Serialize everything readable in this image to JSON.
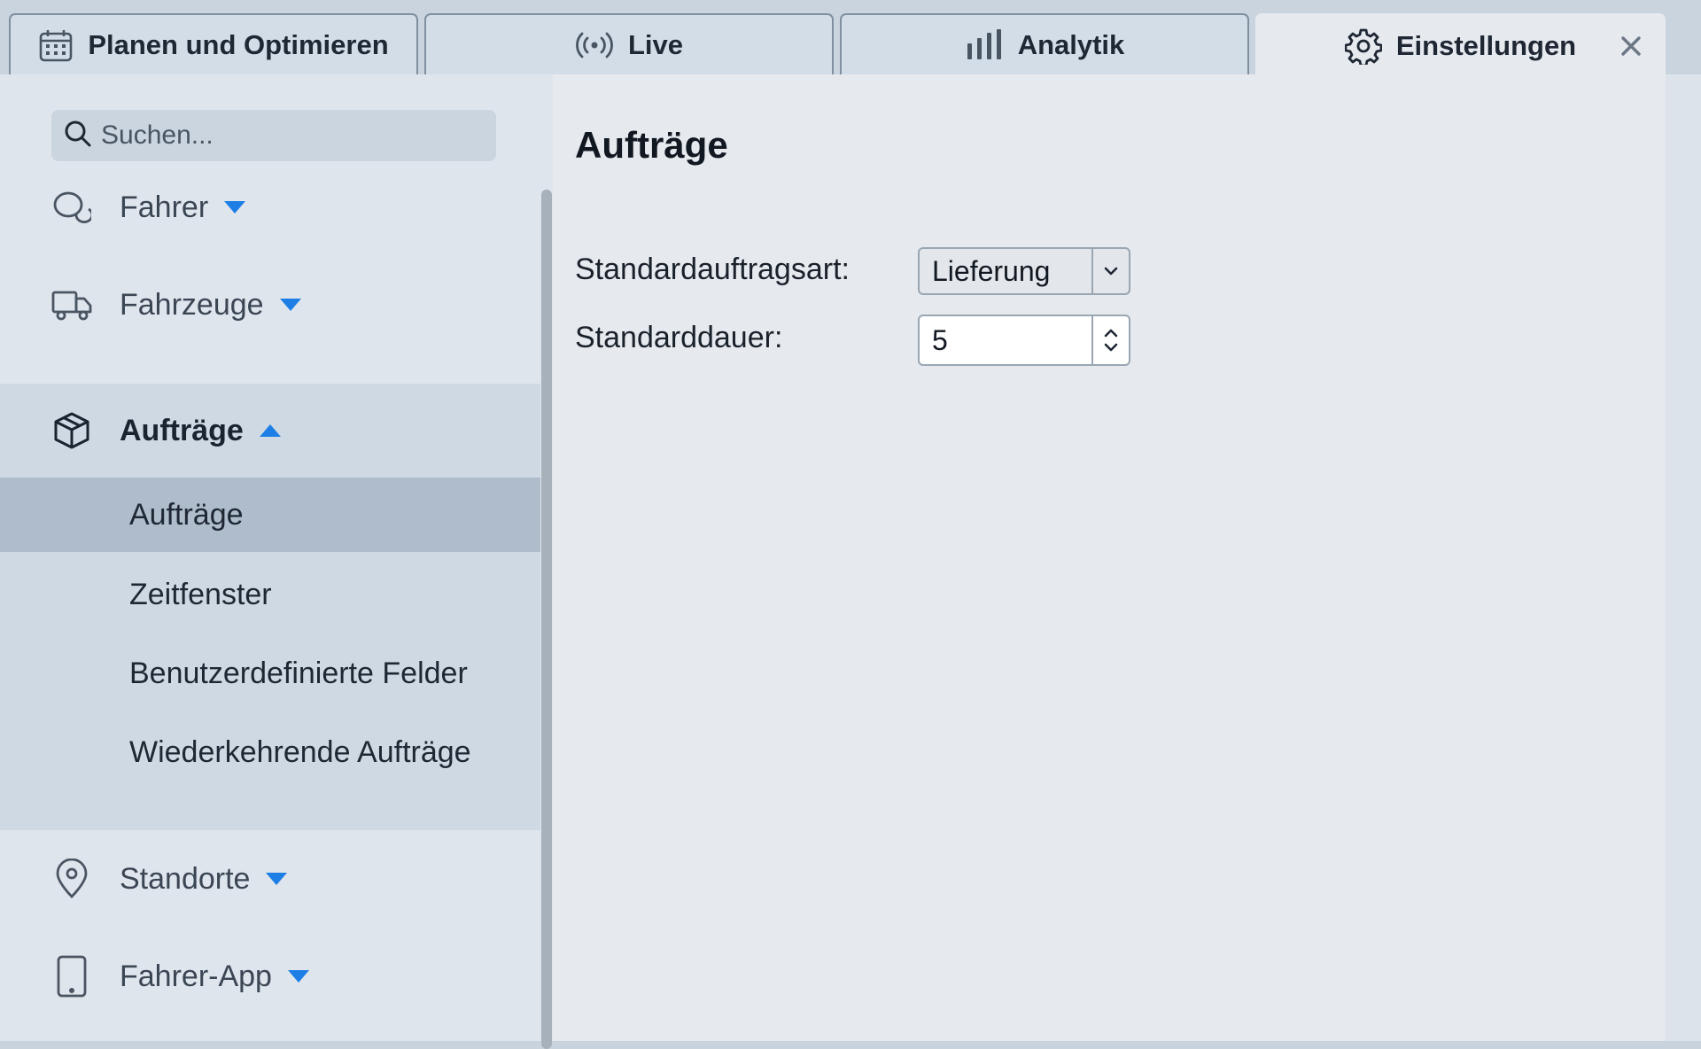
{
  "tabs": [
    {
      "label": "Planen und Optimieren",
      "icon": "calendar-icon"
    },
    {
      "label": "Live",
      "icon": "broadcast-icon"
    },
    {
      "label": "Analytik",
      "icon": "bar-chart-icon"
    },
    {
      "label": "Einstellungen",
      "icon": "gear-icon",
      "active": true
    }
  ],
  "search": {
    "placeholder": "Suchen..."
  },
  "sidebar": {
    "items": [
      {
        "label": "Fahrer",
        "icon": "driver-icon",
        "expanded": false
      },
      {
        "label": "Fahrzeuge",
        "icon": "truck-icon",
        "expanded": false
      },
      {
        "label": "Aufträge",
        "icon": "package-icon",
        "expanded": true,
        "children": [
          {
            "label": "Aufträge",
            "selected": true
          },
          {
            "label": "Zeitfenster"
          },
          {
            "label": "Benutzerdefinierte Felder"
          },
          {
            "label": "Wiederkehrende Aufträge"
          }
        ]
      },
      {
        "label": "Standorte",
        "icon": "location-pin-icon",
        "expanded": false
      },
      {
        "label": "Fahrer-App",
        "icon": "phone-icon",
        "expanded": false
      }
    ]
  },
  "main": {
    "title": "Aufträge",
    "fields": {
      "order_type_label": "Standardauftragsart:",
      "order_type_value": "Lieferung",
      "duration_label": "Standarddauer:",
      "duration_value": "5"
    }
  },
  "colors": {
    "accent": "#1d7fe6",
    "selected_row": "#aebccc",
    "group_bg": "#cfd9e3"
  }
}
